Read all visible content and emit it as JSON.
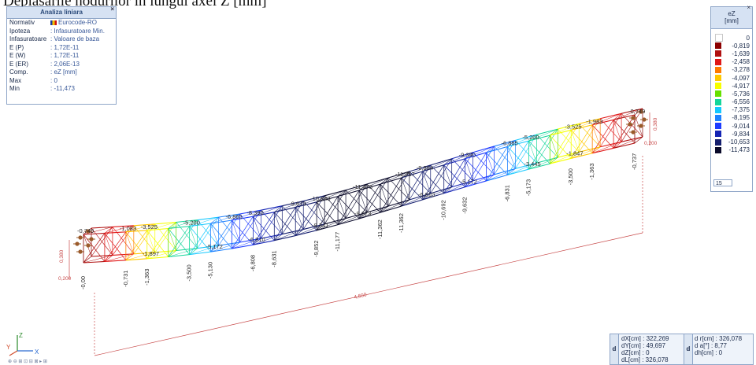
{
  "caption": "Deplasările nodurilor în lungul axei Z [mm]",
  "info_panel": {
    "title": "Analiza liniara",
    "close_glyph": "×",
    "rows": [
      {
        "key": "Normativ",
        "value": "Eurocode-RO"
      },
      {
        "key": "Ipoteza",
        "value": ": Infasuratoare Min."
      },
      {
        "key": "Infasuratoare",
        "value": ": Valoare de baza"
      },
      {
        "key": "E (P)",
        "value": ": 1,72E-11"
      },
      {
        "key": "E (W)",
        "value": ": 1,72E-11"
      },
      {
        "key": "E (ER)",
        "value": ": 2,06E-13"
      },
      {
        "key": "Comp.",
        "value": ": eZ [mm]"
      },
      {
        "key": "Max",
        "value": ": 0"
      },
      {
        "key": "Min",
        "value": ": -11,473"
      }
    ]
  },
  "legend": {
    "title": "eZ",
    "unit": "[mm]",
    "close_glyph": "×",
    "entries": [
      {
        "value": "0",
        "color": "#ffffff"
      },
      {
        "value": "-0,819",
        "color": "#8b0000"
      },
      {
        "value": "-1,639",
        "color": "#b01010"
      },
      {
        "value": "-2,458",
        "color": "#e01818"
      },
      {
        "value": "-3,278",
        "color": "#ff7a00"
      },
      {
        "value": "-4,097",
        "color": "#ffc800"
      },
      {
        "value": "-4,917",
        "color": "#f6ff00"
      },
      {
        "value": "-5,736",
        "color": "#66e000"
      },
      {
        "value": "-6,556",
        "color": "#14d69a"
      },
      {
        "value": "-7,375",
        "color": "#14c8ff"
      },
      {
        "value": "-8,195",
        "color": "#1e82ff"
      },
      {
        "value": "-9,014",
        "color": "#1e3cff"
      },
      {
        "value": "-9,834",
        "color": "#1424b4"
      },
      {
        "value": "-10,653",
        "color": "#141e6e"
      },
      {
        "value": "-11,473",
        "color": "#0a0a2a"
      }
    ],
    "step_value": "15"
  },
  "colors": {
    "dimension": "#c84a4a",
    "support": "#9a5a2a",
    "panel_border": "#8fa6c8"
  },
  "structure": {
    "node_labels": [
      "-0,749",
      "-1,083",
      "-3,525",
      "-5,200",
      "-6,865",
      "-8,390",
      "-9,673",
      "-10,843",
      "-11,473",
      "-11,257",
      "-9,864",
      "-9,390",
      "-6,865",
      "-5,200",
      "-3,525",
      "-1,983",
      "-0,749",
      "-0,00",
      "-0,731",
      "-1,363",
      "-3,500",
      "-5,130",
      "-6,808",
      "-8,631",
      "-9,852",
      "-11,177",
      "-11,362",
      "-11,362",
      "-10,692",
      "-9,632",
      "-6,831",
      "-5,173",
      "-3,500",
      "-1,363",
      "-0,737",
      "-1,897",
      "-5,172",
      "-6,810",
      "-8,341",
      "-9,673",
      "-6,810",
      "-5,172",
      "-3,445",
      "-1,847"
    ],
    "dim_length": "4,600",
    "dim_height_left": "0,380",
    "dim_width_left": "0,200",
    "dim_height_right": "0,380",
    "dim_width_right": "0,200"
  },
  "coords": {
    "side_glyph": "d",
    "left": [
      "dX[cm] : 322,269",
      "dY[cm] : 49,697",
      "dZ[cm] : 0",
      "dL[cm] : 326,078"
    ],
    "right": [
      "d r[cm] : 326,078",
      "d  a[°] : 8,77",
      "dh[cm] : 0"
    ]
  },
  "axes": {
    "z": "Z",
    "x": "X",
    "y": "Y"
  },
  "statusbar": "⊕ ⊖ ⊞ ⊡ ⊟ ⊠ ▸ ⊞"
}
